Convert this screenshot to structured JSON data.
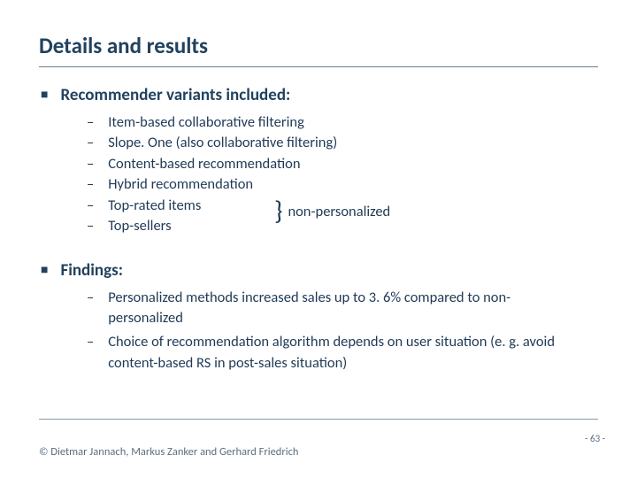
{
  "title": "Details and results",
  "sections": {
    "variants": {
      "heading": "Recommender variants included:",
      "items": [
        "Item-based collaborative filtering",
        "Slope. One (also collaborative filtering)",
        "Content-based recommendation",
        "Hybrid recommendation",
        "Top-rated items",
        "Top-sellers"
      ],
      "annotation": "non-personalized"
    },
    "findings": {
      "heading": "Findings:",
      "items": [
        "Personalized methods increased sales up to 3. 6% compared to non-personalized",
        "Choice of recommendation algorithm depends on user situation (e. g. avoid content-based RS in post-sales situation)"
      ]
    }
  },
  "footer": {
    "copyright": "© Dietmar Jannach, Markus Zanker and Gerhard Friedrich",
    "page": "- 63 -"
  }
}
